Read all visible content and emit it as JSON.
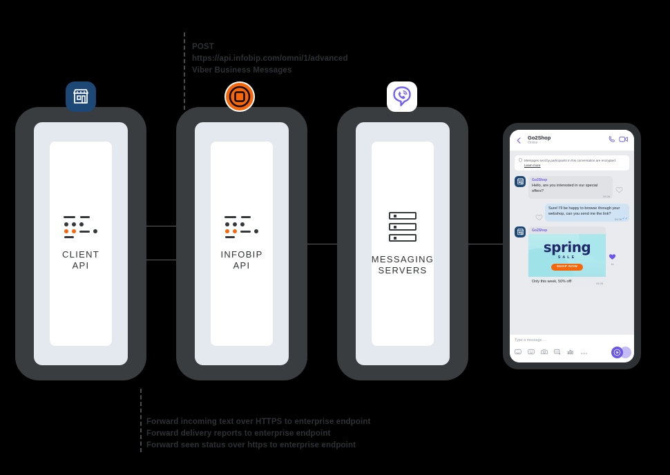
{
  "annotations": {
    "top": [
      "POST",
      "https://api.infobip.com/omni/1/advanced",
      "Viber Business Messages"
    ],
    "bottom": [
      "Forward incoming text over HTTPS to enterprise endpoint",
      "Forward delivery reports to enterprise endpoint",
      "Forward seen status over https to enterprise endpoint"
    ]
  },
  "nodes": [
    {
      "id": "client-api",
      "line1": "CLIENT",
      "line2": "API",
      "icon": "api-dots-icon",
      "badge": "storefront-icon"
    },
    {
      "id": "infobip-api",
      "line1": "INFOBIP",
      "line2": "API",
      "icon": "api-dots-icon",
      "badge": "infobip-logo-icon"
    },
    {
      "id": "messaging-servers",
      "line1": "MESSAGING",
      "line2": "SERVERS",
      "icon": "server-stack-icon",
      "badge": "viber-logo-icon"
    }
  ],
  "chat": {
    "header": {
      "name": "Go2Shop",
      "status": "Online",
      "back_icon": "back-arrow-icon",
      "call_icon": "phone-call-icon",
      "video_icon": "video-call-icon"
    },
    "encryption_notice": {
      "icon": "lock-shield-icon",
      "text": "Messages sent by participants in this conversation are encrypted.",
      "link": "Learn more"
    },
    "messages": [
      {
        "direction": "in",
        "sender": "Go2Shop",
        "text": "Hello, are you interested in our special offers?",
        "time": "09:28",
        "reaction_icon": "heart-outline-icon"
      },
      {
        "direction": "out",
        "text": "Sure! I'll be happy to browse through your webshop, can you send me the link?",
        "time": "09:28",
        "status_icon": "double-check-icon",
        "reaction_icon": "heart-outline-icon"
      },
      {
        "direction": "in",
        "sender": "Go2Shop",
        "type": "promo-card",
        "art_title": "spring",
        "art_subtitle": "SALE",
        "cta": "SHOP NOW",
        "caption": "Only this week, 50% off!",
        "time": "09:28",
        "reaction_icon": "heart-filled-icon",
        "reaction_count": "46"
      }
    ],
    "composer": {
      "placeholder": "Type a message...",
      "tools": [
        "sticker-icon",
        "emoji-icon",
        "camera-icon",
        "gif-icon",
        "poll-icon",
        "more-icon"
      ],
      "send_icon": "send-button-icon"
    }
  },
  "colors": {
    "device_frame": "#393d3f",
    "device_bezel": "#e4e8ef",
    "accent_orange": "#f86609",
    "viber_purple": "#7360f2",
    "shop_blue": "#1d4876",
    "line_gray": "#5d6164",
    "text_dark": "#2e3133"
  }
}
